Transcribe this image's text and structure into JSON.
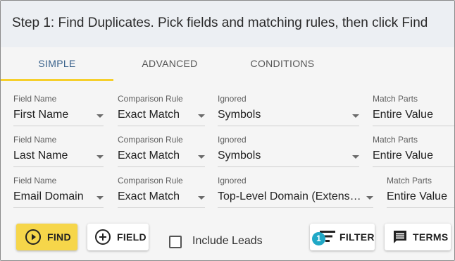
{
  "header": {
    "title": "Step 1: Find Duplicates. Pick fields and matching rules, then click Find"
  },
  "tabs": [
    {
      "label": "SIMPLE",
      "active": true
    },
    {
      "label": "ADVANCED",
      "active": false
    },
    {
      "label": "CONDITIONS",
      "active": false
    }
  ],
  "labels": {
    "field_name": "Field Name",
    "comparison_rule": "Comparison Rule",
    "ignored": "Ignored",
    "match_parts": "Match Parts"
  },
  "rows": [
    {
      "field": "First Name",
      "comparison": "Exact Match",
      "ignored": "Symbols",
      "match_parts": "Entire Value"
    },
    {
      "field": "Last Name",
      "comparison": "Exact Match",
      "ignored": "Symbols",
      "match_parts": "Entire Value"
    },
    {
      "field": "Email Domain",
      "comparison": "Exact Match",
      "ignored": "Top-Level Domain (Extens…",
      "match_parts": "Entire Value"
    }
  ],
  "buttons": {
    "find": "FIND",
    "field": "FIELD",
    "filter": "FILTER",
    "filter_badge": "1",
    "terms": "TERMS"
  },
  "include_leads": {
    "label": "Include Leads",
    "checked": false
  },
  "colors": {
    "accent": "#f6d64a",
    "tab_active": "#37608a",
    "badge": "#20a8c6"
  }
}
